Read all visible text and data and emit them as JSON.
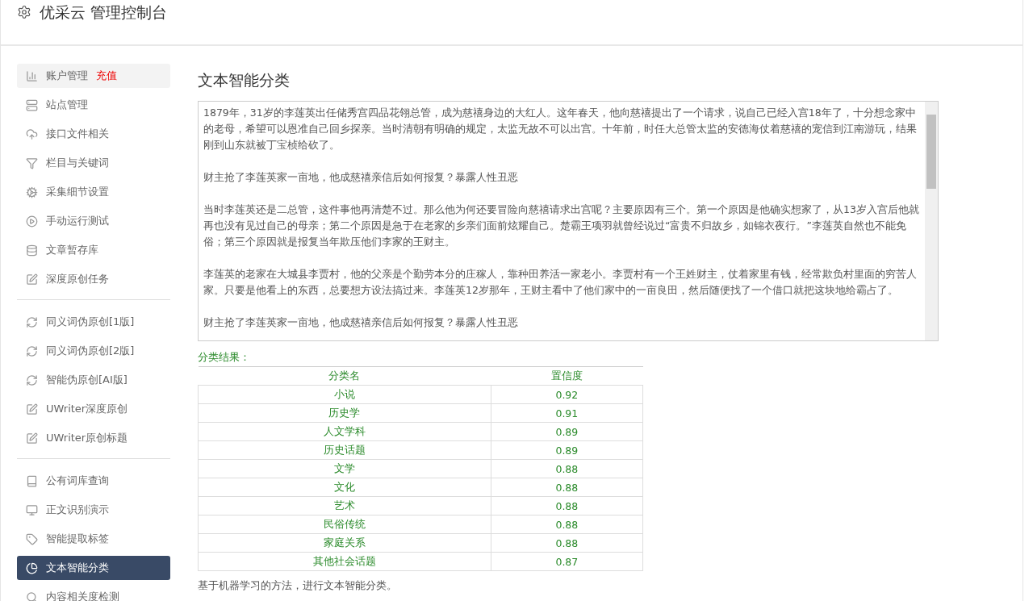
{
  "header": {
    "title": "优采云 管理控制台"
  },
  "sidebar": {
    "groups": [
      {
        "items": [
          {
            "label": "账户管理",
            "badge": "充值",
            "selected": false
          },
          {
            "label": "站点管理",
            "selected": false
          },
          {
            "label": "接口文件相关",
            "selected": false
          },
          {
            "label": "栏目与关键词",
            "selected": false
          },
          {
            "label": "采集细节设置",
            "selected": false
          },
          {
            "label": "手动运行测试",
            "selected": false
          },
          {
            "label": "文章暂存库",
            "selected": false
          },
          {
            "label": "深度原创任务",
            "selected": false
          }
        ]
      },
      {
        "items": [
          {
            "label": "同义词伪原创[1版]",
            "selected": false
          },
          {
            "label": "同义词伪原创[2版]",
            "selected": false
          },
          {
            "label": "智能伪原创[AI版]",
            "selected": false
          },
          {
            "label": "UWriter深度原创",
            "selected": false
          },
          {
            "label": "UWriter原创标题",
            "selected": false
          }
        ]
      },
      {
        "items": [
          {
            "label": "公有词库查询",
            "selected": false
          },
          {
            "label": "正文识别演示",
            "selected": false
          },
          {
            "label": "智能提取标签",
            "selected": false
          },
          {
            "label": "文本智能分类",
            "selected": true
          },
          {
            "label": "内容相关度检测",
            "selected": false
          }
        ]
      }
    ]
  },
  "main": {
    "title": "文本智能分类",
    "text_input": {
      "paragraphs": [
        "1879年，31岁的李莲英出任储秀宫四品花翎总管，成为慈禧身边的大红人。这年春天，他向慈禧提出了一个请求，说自己已经入宫18年了，十分想念家中的老母，希望可以恩准自己回乡探亲。当时清朝有明确的规定，太监无故不可以出宫。十年前，时任大总管太监的安德海仗着慈禧的宠信到江南游玩，结果刚到山东就被丁宝桢给砍了。",
        "财主抢了李莲英家一亩地，他成慈禧亲信后如何报复？暴露人性丑恶",
        "当时李莲英还是二总管，这件事他再清楚不过。那么他为何还要冒险向慈禧请求出宫呢？主要原因有三个。第一个原因是他确实想家了，从13岁入宫后他就再也没有见过自己的母亲；第二个原因是急于在老家的乡亲们面前炫耀自己。楚霸王项羽就曾经说过“富贵不归故乡，如锦衣夜行。”李莲英自然也不能免俗；第三个原因就是报复当年欺压他们李家的王财主。",
        "李莲英的老家在大城县李贾村，他的父亲是个勤劳本分的庄稼人，靠种田养活一家老小。李贾村有一个王姓财主，仗着家里有钱，经常欺负村里面的穷苦人家。只要是他看上的东西，总要想方设法搞过来。李莲英12岁那年，王财主看中了他们家中的一亩良田，然后随便找了一个借口就把这块地给霸占了。",
        "财主抢了李莲英家一亩地，他成慈禧亲信后如何报复？暴露人性丑恶"
      ]
    },
    "result_label": "分类结果：",
    "table": {
      "columns": [
        "分类名",
        "置信度"
      ],
      "rows": [
        [
          "小说",
          "0.92"
        ],
        [
          "历史学",
          "0.91"
        ],
        [
          "人文学科",
          "0.89"
        ],
        [
          "历史话题",
          "0.89"
        ],
        [
          "文学",
          "0.88"
        ],
        [
          "文化",
          "0.88"
        ],
        [
          "艺术",
          "0.88"
        ],
        [
          "民俗传统",
          "0.88"
        ],
        [
          "家庭关系",
          "0.88"
        ],
        [
          "其他社会话题",
          "0.87"
        ]
      ]
    },
    "footer_note": "基于机器学习的方法，进行文本智能分类。"
  }
}
